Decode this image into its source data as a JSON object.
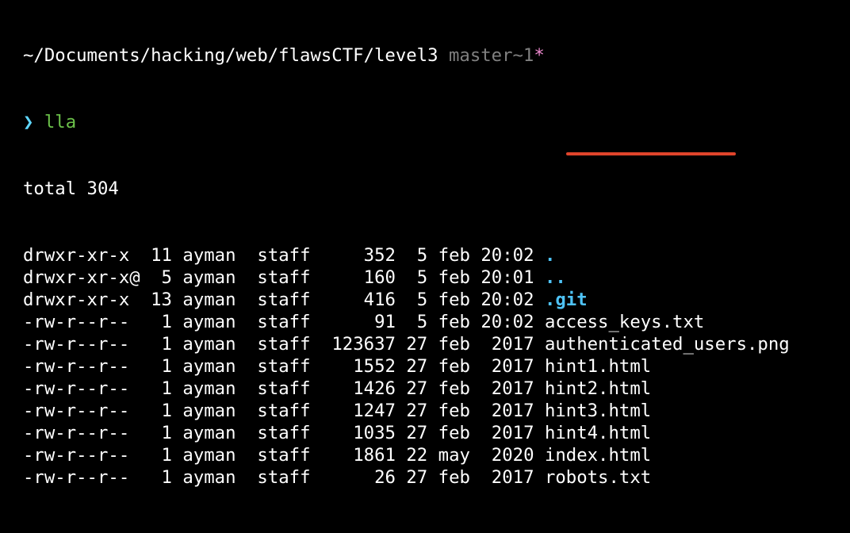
{
  "prompt": {
    "path": "~/Documents/hacking/web/flawsCTF/level3",
    "git_branch": "master~1",
    "git_dirty": "*",
    "arrow": "❯",
    "command": "lla"
  },
  "total": "total 304",
  "listing": [
    {
      "perms": "drwxr-xr-x ",
      "links": "11",
      "owner": "ayman",
      "group": "staff",
      "size": "352",
      "day": "5",
      "month": "feb",
      "time": "20:02",
      "name": ".",
      "is_dir": true
    },
    {
      "perms": "drwxr-xr-x@",
      "links": "5",
      "owner": "ayman",
      "group": "staff",
      "size": "160",
      "day": "5",
      "month": "feb",
      "time": "20:01",
      "name": "..",
      "is_dir": true
    },
    {
      "perms": "drwxr-xr-x ",
      "links": "13",
      "owner": "ayman",
      "group": "staff",
      "size": "416",
      "day": "5",
      "month": "feb",
      "time": "20:02",
      "name": ".git",
      "is_dir": true
    },
    {
      "perms": "-rw-r--r-- ",
      "links": "1",
      "owner": "ayman",
      "group": "staff",
      "size": "91",
      "day": "5",
      "month": "feb",
      "time": "20:02",
      "name": "access_keys.txt",
      "is_dir": false,
      "highlighted": true
    },
    {
      "perms": "-rw-r--r-- ",
      "links": "1",
      "owner": "ayman",
      "group": "staff",
      "size": "123637",
      "day": "27",
      "month": "feb",
      "time": "2017",
      "name": "authenticated_users.png",
      "is_dir": false
    },
    {
      "perms": "-rw-r--r-- ",
      "links": "1",
      "owner": "ayman",
      "group": "staff",
      "size": "1552",
      "day": "27",
      "month": "feb",
      "time": "2017",
      "name": "hint1.html",
      "is_dir": false
    },
    {
      "perms": "-rw-r--r-- ",
      "links": "1",
      "owner": "ayman",
      "group": "staff",
      "size": "1426",
      "day": "27",
      "month": "feb",
      "time": "2017",
      "name": "hint2.html",
      "is_dir": false
    },
    {
      "perms": "-rw-r--r-- ",
      "links": "1",
      "owner": "ayman",
      "group": "staff",
      "size": "1247",
      "day": "27",
      "month": "feb",
      "time": "2017",
      "name": "hint3.html",
      "is_dir": false
    },
    {
      "perms": "-rw-r--r-- ",
      "links": "1",
      "owner": "ayman",
      "group": "staff",
      "size": "1035",
      "day": "27",
      "month": "feb",
      "time": "2017",
      "name": "hint4.html",
      "is_dir": false
    },
    {
      "perms": "-rw-r--r-- ",
      "links": "1",
      "owner": "ayman",
      "group": "staff",
      "size": "1861",
      "day": "22",
      "month": "may",
      "time": "2020",
      "name": "index.html",
      "is_dir": false
    },
    {
      "perms": "-rw-r--r-- ",
      "links": "1",
      "owner": "ayman",
      "group": "staff",
      "size": "26",
      "day": "27",
      "month": "feb",
      "time": "2017",
      "name": "robots.txt",
      "is_dir": false
    }
  ],
  "colors": {
    "background": "#000000",
    "text": "#ffffff",
    "branch": "#808080",
    "dirty_marker": "#f08ad0",
    "prompt_arrow": "#5fd7ff",
    "command": "#6cc24a",
    "directory": "#4fc3f7",
    "highlight_underline": "#e0442b"
  }
}
